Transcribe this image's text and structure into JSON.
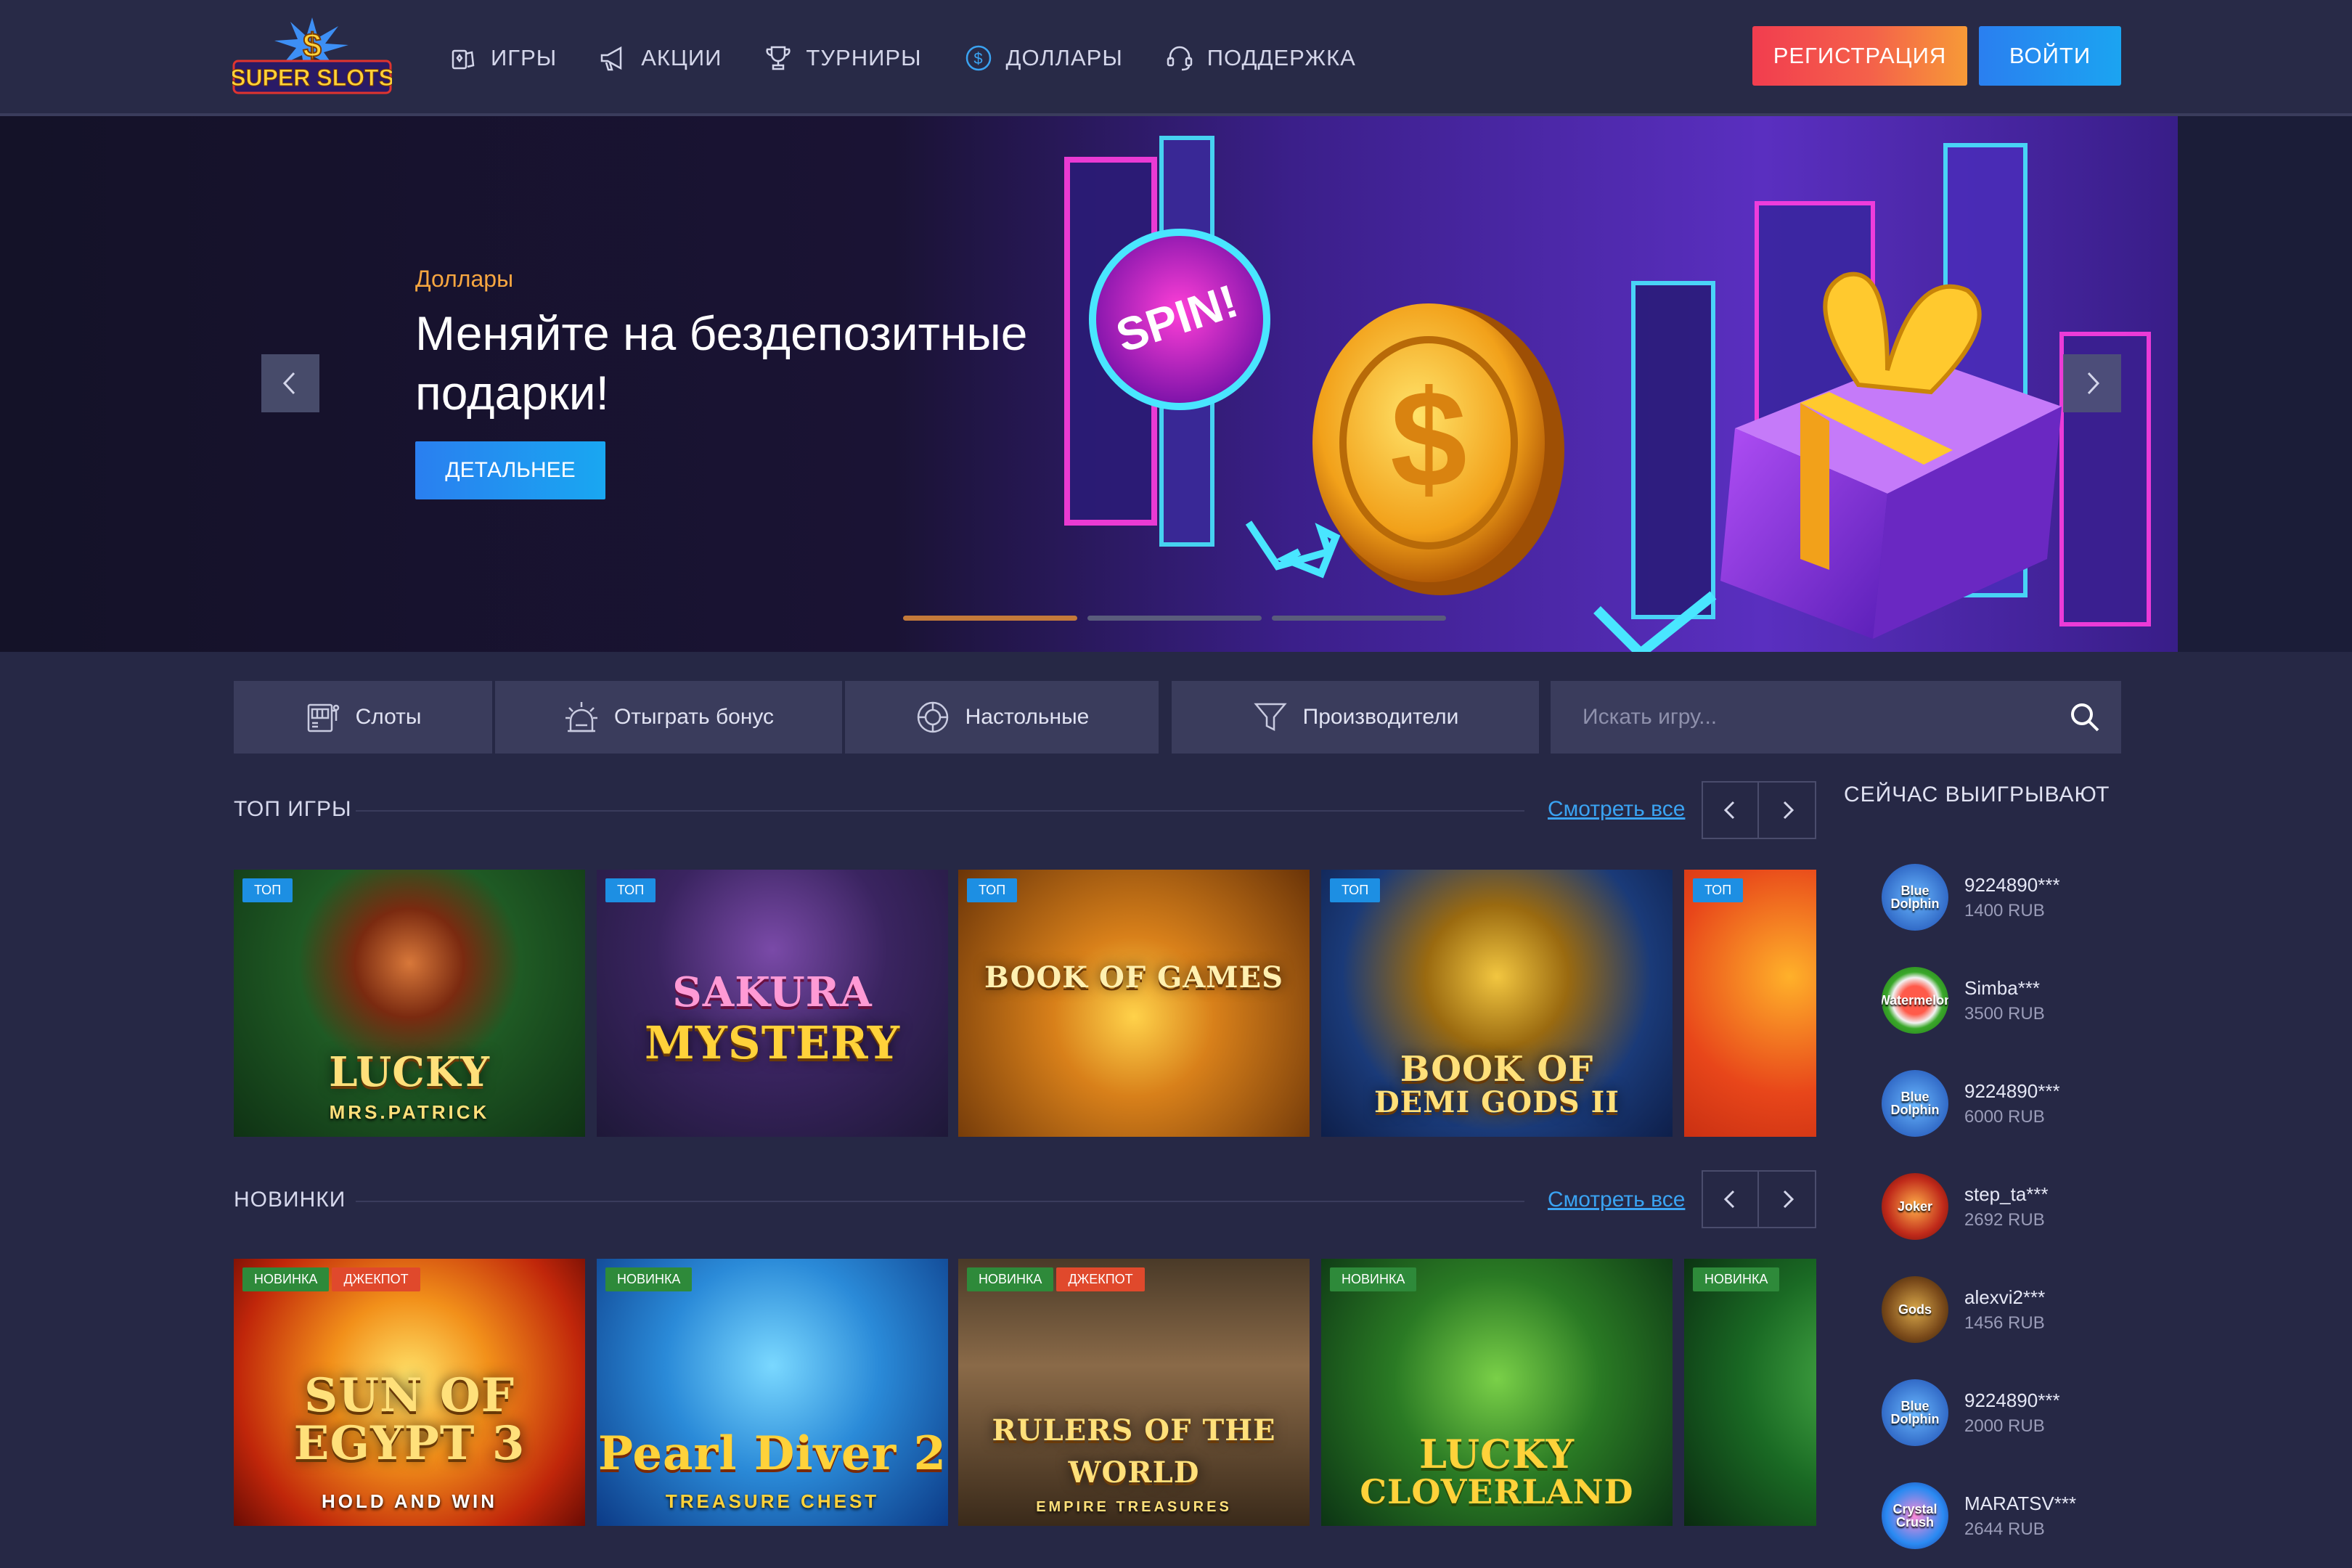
{
  "header": {
    "logo_text": "SUPER SLOTS",
    "nav": [
      {
        "label": "ИГРЫ",
        "icon": "cards-icon"
      },
      {
        "label": "АКЦИИ",
        "icon": "megaphone-icon"
      },
      {
        "label": "ТУРНИРЫ",
        "icon": "trophy-icon"
      },
      {
        "label": "ДОЛЛАРЫ",
        "icon": "dollar-icon"
      },
      {
        "label": "ПОДДЕРЖКА",
        "icon": "headset-icon"
      }
    ],
    "register_label": "РЕГИСТРАЦИЯ",
    "login_label": "ВОЙТИ"
  },
  "hero": {
    "tag": "Доллары",
    "title": "Меняйте на бездепозитные подарки!",
    "button": "ДЕТАЛЬНЕЕ",
    "art_text": "SPIN!",
    "slide_count": 3,
    "active_slide": 1
  },
  "filters": {
    "items": [
      "Слоты",
      "Отыграть бонус",
      "Настольные",
      "Производители"
    ],
    "search_placeholder": "Искать игру..."
  },
  "top_games": {
    "title": "ТОП ИГРЫ",
    "see_all": "Смотреть все",
    "badge": "ТОП",
    "games": [
      {
        "name": "LUCKY",
        "sub": "MRS.PATRICK"
      },
      {
        "name": "SAKURA",
        "sub": "MYSTERY"
      },
      {
        "name": "BOOK OF GAMES",
        "sub": ""
      },
      {
        "name": "BOOK OF",
        "sub": "DEMI GODS II"
      },
      {
        "name": "",
        "sub": ""
      }
    ]
  },
  "new_games": {
    "title": "НОВИНКИ",
    "see_all": "Смотреть все",
    "badge_new": "НОВИНКА",
    "badge_jackpot": "ДЖЕКПОТ",
    "games": [
      {
        "name": "SUN OF EGYPT 3",
        "sub": "HOLD AND WIN",
        "jackpot": true
      },
      {
        "name": "Pearl Diver 2",
        "sub": "TREASURE CHEST",
        "jackpot": false
      },
      {
        "name": "RULERS OF THE WORLD",
        "sub": "EMPIRE TREASURES",
        "jackpot": true
      },
      {
        "name": "LUCKY",
        "sub": "CLOVERLAND",
        "jackpot": false
      },
      {
        "name": "",
        "sub": "",
        "jackpot": false
      }
    ]
  },
  "winners": {
    "title": "СЕЙЧАС ВЫИГРЫВАЮТ",
    "list": [
      {
        "name": "9224890***",
        "amount": "1400 RUB",
        "avatar": "Blue Dolphin"
      },
      {
        "name": "Simba***",
        "amount": "3500 RUB",
        "avatar": "Watermelon"
      },
      {
        "name": "9224890***",
        "amount": "6000 RUB",
        "avatar": "Blue Dolphin"
      },
      {
        "name": "step_ta***",
        "amount": "2692 RUB",
        "avatar": "Joker"
      },
      {
        "name": "alexvi2***",
        "amount": "1456 RUB",
        "avatar": "Gods"
      },
      {
        "name": "9224890***",
        "amount": "2000 RUB",
        "avatar": "Blue Dolphin"
      },
      {
        "name": "MARATSV***",
        "amount": "2644 RUB",
        "avatar": "Crystal Crush"
      }
    ]
  },
  "colors": {
    "background": "#262845",
    "header": "#282a47",
    "panel": "#3a3c5c",
    "accent_blue": "#2a7ff0",
    "accent_red": "#f23d4f",
    "accent_orange": "#f7a640",
    "link": "#3aa3f2"
  }
}
